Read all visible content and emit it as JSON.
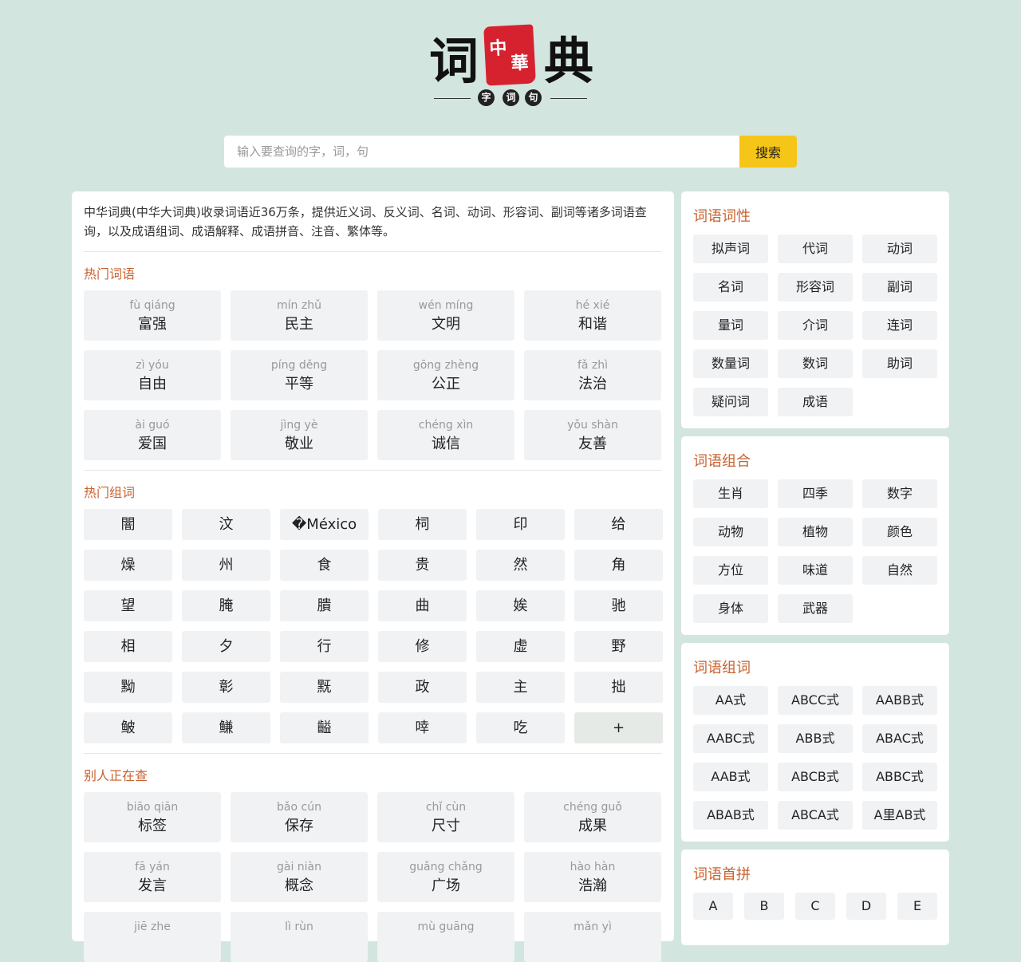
{
  "logo": {
    "left_char": "词",
    "seal_chars": [
      "中",
      "華"
    ],
    "right_char": "典",
    "circle_chars": [
      "字",
      "词",
      "句"
    ]
  },
  "search": {
    "placeholder": "输入要查询的字，词，句",
    "button_label": "搜索"
  },
  "main": {
    "intro": "中华词典(中华大词典)收录词语近36万条，提供近义词、反义词、名词、动词、形容词、副词等诸多词语查询，以及成语组词、成语解释、成语拼音、注音、繁体等。",
    "hot_words": {
      "title": "热门词语",
      "items": [
        {
          "pinyin": "fù qiáng",
          "word": "富强"
        },
        {
          "pinyin": "mín zhǔ",
          "word": "民主"
        },
        {
          "pinyin": "wén míng",
          "word": "文明"
        },
        {
          "pinyin": "hé xié",
          "word": "和谐"
        },
        {
          "pinyin": "zì yóu",
          "word": "自由"
        },
        {
          "pinyin": "píng děng",
          "word": "平等"
        },
        {
          "pinyin": "gōng zhèng",
          "word": "公正"
        },
        {
          "pinyin": "fǎ zhì",
          "word": "法治"
        },
        {
          "pinyin": "ài guó",
          "word": "爱国"
        },
        {
          "pinyin": "jìng yè",
          "word": "敬业"
        },
        {
          "pinyin": "chéng xìn",
          "word": "诚信"
        },
        {
          "pinyin": "yǒu shàn",
          "word": "友善"
        }
      ]
    },
    "hot_chars": {
      "title": "热门组词",
      "items": [
        "闇",
        "汶",
        "�México",
        "柌",
        "印",
        "给",
        "燥",
        "州",
        "食",
        "贵",
        "然",
        "角",
        "望",
        "腌",
        "膭",
        "曲",
        "娭",
        "驰",
        "相",
        "夕",
        "行",
        "修",
        "虚",
        "野",
        "黝",
        "彰",
        "黖",
        "政",
        "主",
        "拙",
        "鲏",
        "鳒",
        "齸",
        "啈",
        "吃"
      ],
      "more_label": "+"
    },
    "recent": {
      "title": "别人正在查",
      "items": [
        {
          "pinyin": "biāo qiān",
          "word": "标签"
        },
        {
          "pinyin": "bǎo cún",
          "word": "保存"
        },
        {
          "pinyin": "chǐ cùn",
          "word": "尺寸"
        },
        {
          "pinyin": "chéng guǒ",
          "word": "成果"
        },
        {
          "pinyin": "fā yán",
          "word": "发言"
        },
        {
          "pinyin": "gài niàn",
          "word": "概念"
        },
        {
          "pinyin": "guǎng chǎng",
          "word": "广场"
        },
        {
          "pinyin": "hào hàn",
          "word": "浩瀚"
        },
        {
          "pinyin": "jiē zhe",
          "word": ""
        },
        {
          "pinyin": "lì rùn",
          "word": ""
        },
        {
          "pinyin": "mù guāng",
          "word": ""
        },
        {
          "pinyin": "mǎn yì",
          "word": ""
        }
      ]
    }
  },
  "sidebar": {
    "pos": {
      "title": "词语词性",
      "items": [
        "拟声词",
        "代词",
        "动词",
        "名词",
        "形容词",
        "副词",
        "量词",
        "介词",
        "连词",
        "数量词",
        "数词",
        "助词",
        "疑问词",
        "成语"
      ]
    },
    "combo": {
      "title": "词语组合",
      "items": [
        "生肖",
        "四季",
        "数字",
        "动物",
        "植物",
        "颜色",
        "方位",
        "味道",
        "自然",
        "身体",
        "武器"
      ]
    },
    "pattern": {
      "title": "词语组词",
      "items": [
        "AA式",
        "ABCC式",
        "AABB式",
        "AABC式",
        "ABB式",
        "ABAC式",
        "AAB式",
        "ABCB式",
        "ABBC式",
        "ABAB式",
        "ABCA式",
        "A里AB式"
      ]
    },
    "initials": {
      "title": "词语首拼",
      "items": [
        "A",
        "B",
        "C",
        "D",
        "E"
      ]
    }
  }
}
